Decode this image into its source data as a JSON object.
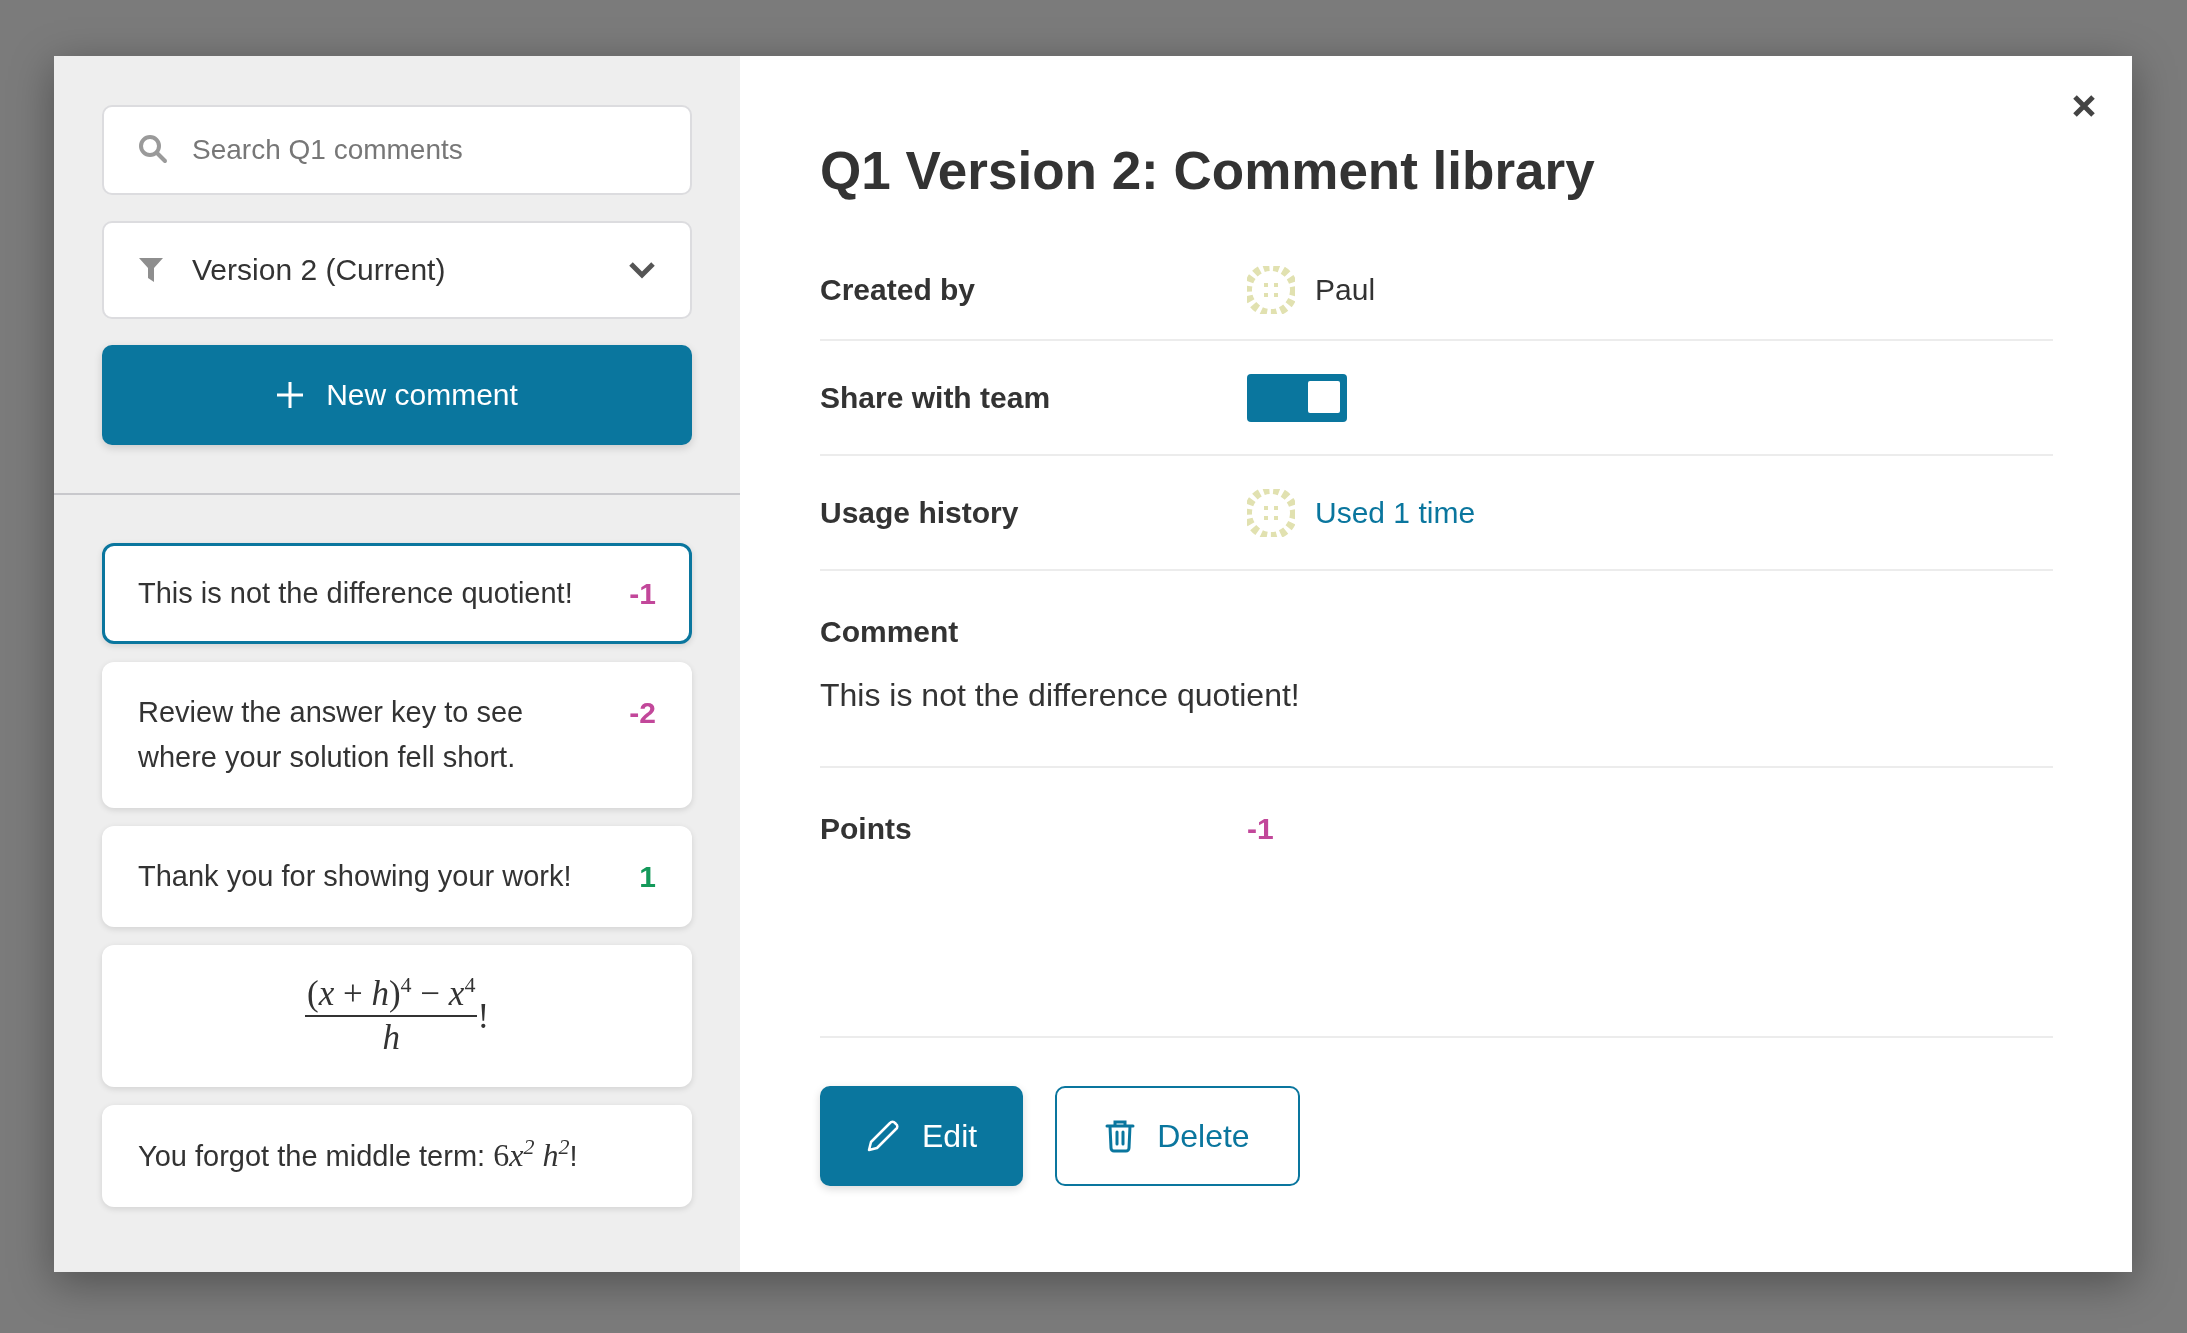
{
  "search": {
    "placeholder": "Search Q1 comments"
  },
  "version_select": {
    "value": "Version 2 (Current)"
  },
  "new_comment_button": {
    "label": "New comment"
  },
  "comments": [
    {
      "kind": "text",
      "text": "This is not the difference quotient!",
      "points": "-1",
      "color": "#c2479a",
      "selected": true
    },
    {
      "kind": "text",
      "text": "Review the answer key to see where your solution fell short.",
      "points": "-2",
      "color": "#c2479a",
      "selected": false
    },
    {
      "kind": "text",
      "text": "Thank you for showing your work!",
      "points": "1",
      "color": "#14995a",
      "selected": false
    },
    {
      "kind": "fraction",
      "numerator": "(*x* + *h*)$^{4}$ − *x*$^{4}$",
      "denominator": "*h*",
      "suffix": "!",
      "selected": false
    },
    {
      "kind": "text_math",
      "text": "You forgot the middle term:",
      "coefficient": "6",
      "math": "x$^{2}$ h$^{2}$",
      "suffix": "!",
      "selected": false
    }
  ],
  "detail": {
    "title": "Q1 Version 2: Comment library",
    "fields": [
      {
        "kind": "person",
        "label": "Created by",
        "value": "Paul"
      },
      {
        "kind": "toggle",
        "label": "Share with team",
        "on": true
      },
      {
        "kind": "link",
        "label": "Usage history",
        "value": "Used 1 time"
      }
    ],
    "comment": {
      "label": "Comment",
      "text": "This is not the difference quotient!"
    },
    "points": {
      "label": "Points",
      "value": "-1",
      "color": "#c2479a"
    },
    "buttons": [
      {
        "kind": "primary",
        "label": "Edit"
      },
      {
        "kind": "secondary",
        "label": "Delete"
      }
    ]
  }
}
